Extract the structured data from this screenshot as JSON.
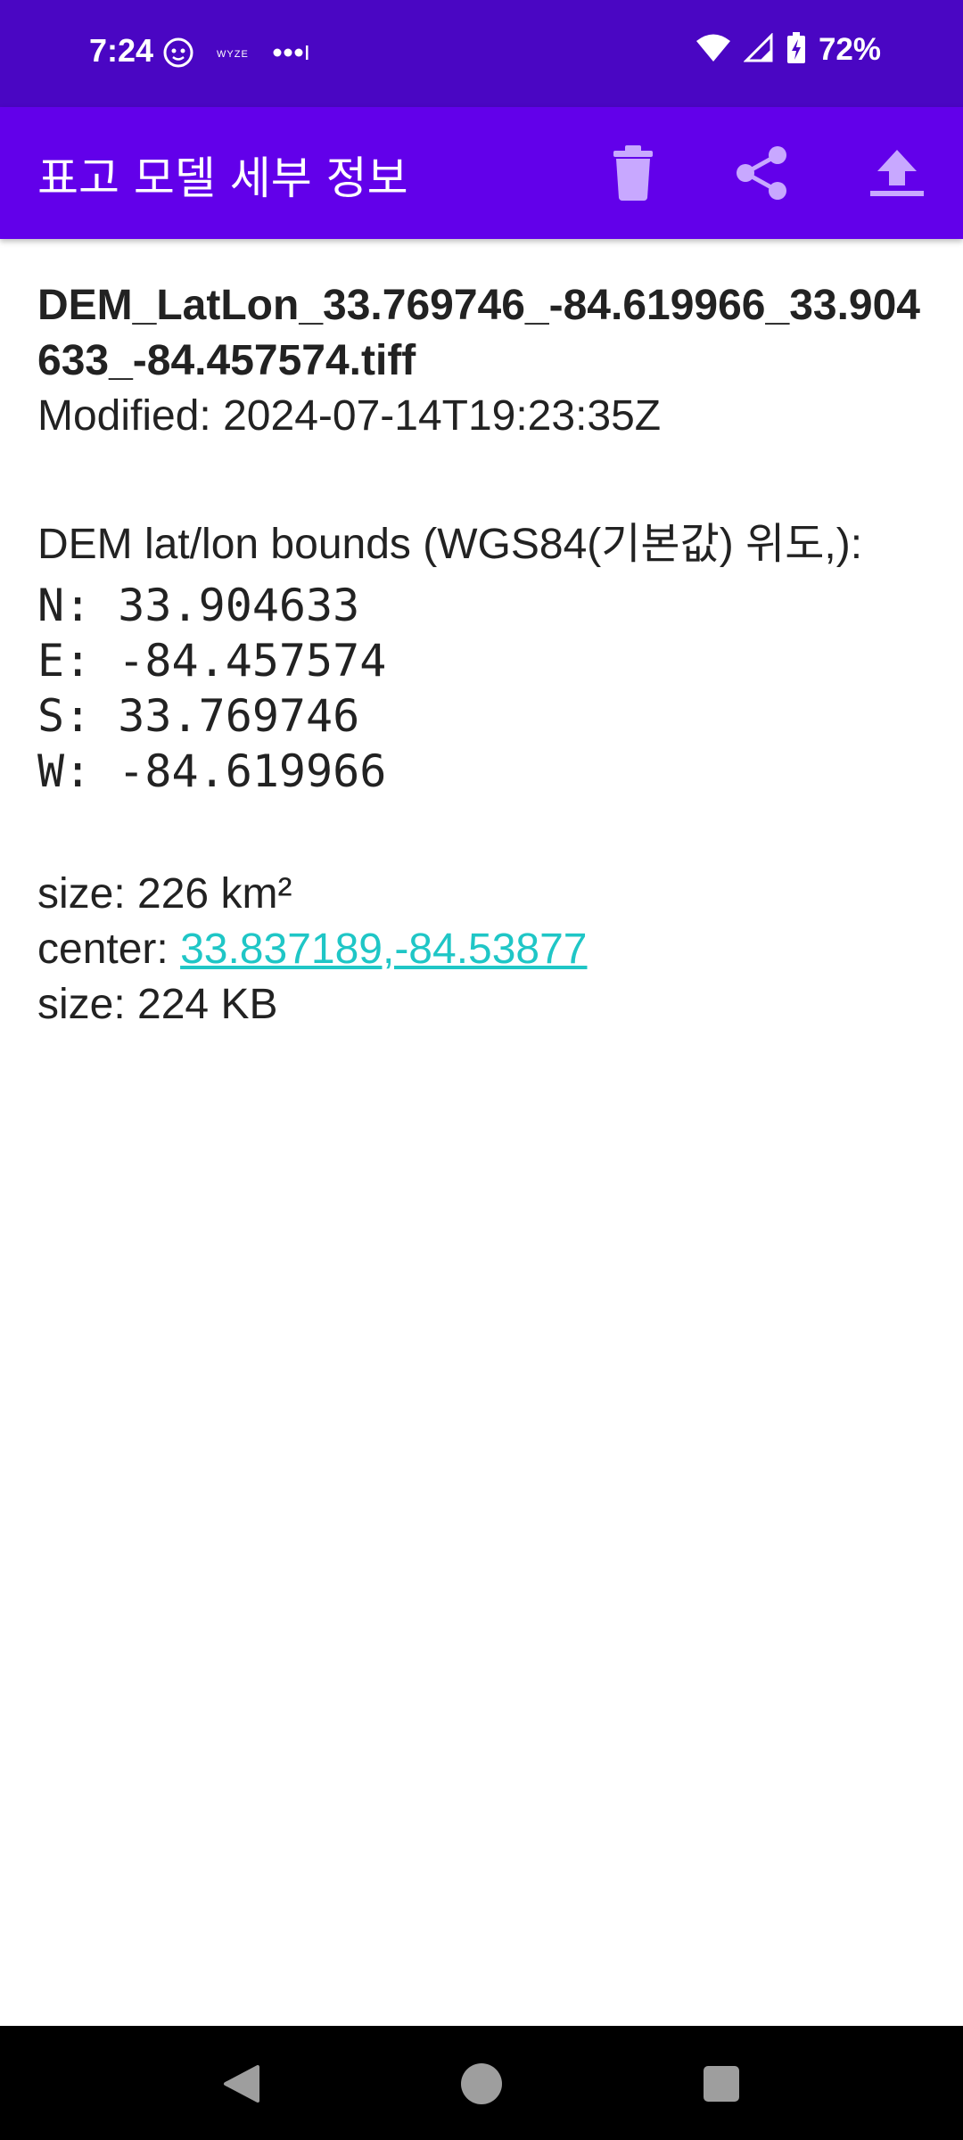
{
  "status_bar": {
    "time": "7:24",
    "battery": "72%",
    "left_icons": [
      "face-icon",
      "wyze-icon",
      "more-dots-icon"
    ],
    "right_icons": [
      "wifi-icon",
      "signal-icon",
      "battery-charging-icon"
    ],
    "wyze_label": "WYZE"
  },
  "app_bar": {
    "title": "표고 모델 세부 정보",
    "actions": [
      "delete-icon",
      "share-icon",
      "upload-icon"
    ]
  },
  "details": {
    "file_name": "DEM_LatLon_33.769746_-84.619966_33.904633_-84.457574.tiff",
    "modified": "Modified: 2024-07-14T19:23:35Z",
    "bounds_header": "DEM lat/lon bounds (WGS84(기본값) 위도,):",
    "north": "N: 33.904633",
    "east": "E: -84.457574",
    "south": "S: 33.769746",
    "west": "W: -84.619966",
    "area": "size: 226 km²",
    "center_label": "center: ",
    "center_link": "33.837189,-84.53877",
    "file_size": "size: 224 KB"
  },
  "colors": {
    "status_bar": "#4a06c3",
    "app_bar": "#6200ea",
    "link": "#1fc6c6",
    "icon_tint": "#c8a8ff"
  },
  "nav_bar": {
    "buttons": [
      "back-icon",
      "home-icon",
      "recents-icon"
    ]
  }
}
